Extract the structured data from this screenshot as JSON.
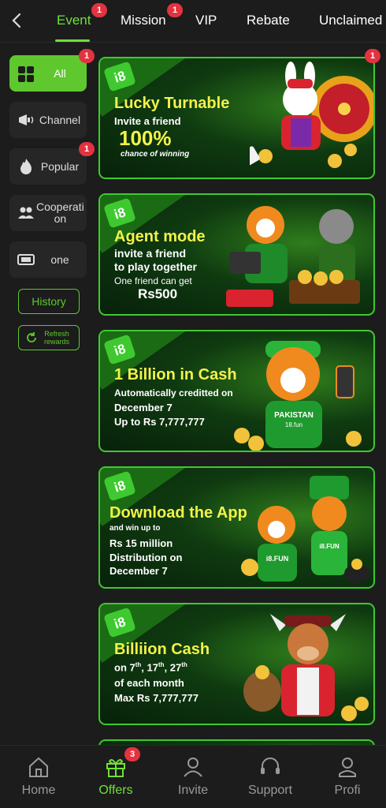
{
  "header": {
    "tabs": [
      {
        "label": "Event",
        "active": true,
        "badge": "1"
      },
      {
        "label": "Mission",
        "badge": "1"
      },
      {
        "label": "VIP"
      },
      {
        "label": "Rebate"
      },
      {
        "label": "Unclaimed"
      }
    ]
  },
  "sidebar": {
    "items": [
      {
        "label": "All",
        "icon": "cards-icon",
        "badge": "1",
        "active": true
      },
      {
        "label": "Channel",
        "icon": "megaphone-icon"
      },
      {
        "label": "Popular",
        "icon": "flame-icon",
        "badge": "1"
      },
      {
        "label": "Cooperati on",
        "icon": "people-icon"
      },
      {
        "label": "one",
        "icon": "ticket-icon"
      }
    ],
    "history_label": "History",
    "refresh_label": "Refresh rewards"
  },
  "banners": [
    {
      "badge": "1",
      "title": "Lucky Turnable",
      "line1": "Invite a friend",
      "big": "100%",
      "small": "chance of winning"
    },
    {
      "title": "Agent mode",
      "line1": "invite a friend",
      "line2": "to play together",
      "line3": "One friend can get",
      "line4": "Rs500"
    },
    {
      "title": "1 Billion in Cash",
      "line1": "Automatically creditted on",
      "line2": "December 7",
      "line3": "Up to Rs 7,777,777",
      "shirt": "PAKISTAN",
      "shirt2": "18.fun"
    },
    {
      "title": "Download the App",
      "line1": "and win up to",
      "line2": "Rs 15 million",
      "line3": "Distribution on",
      "line4": "December 7",
      "shirt": "i8.FUN",
      "shirt2": "i8.FUN"
    },
    {
      "title": "Billiion Cash",
      "line1_pre": "on 7",
      "sup1": "th",
      "sep1": ", 17",
      "sup2": "th",
      "sep2": ", 27",
      "sup3": "th",
      "line2": "of each month",
      "line3": "Max Rs 7,777,777"
    }
  ],
  "bottom_nav": {
    "items": [
      {
        "label": "Home",
        "icon": "home-icon"
      },
      {
        "label": "Offers",
        "icon": "gift-icon",
        "badge": "3",
        "active": true
      },
      {
        "label": "Invite",
        "icon": "invite-icon"
      },
      {
        "label": "Support",
        "icon": "headset-icon"
      },
      {
        "label": "Profi",
        "icon": "profile-icon"
      }
    ]
  },
  "colors": {
    "accent": "#5ec82e",
    "badge": "#e2333f",
    "headline": "#f2f24a"
  }
}
